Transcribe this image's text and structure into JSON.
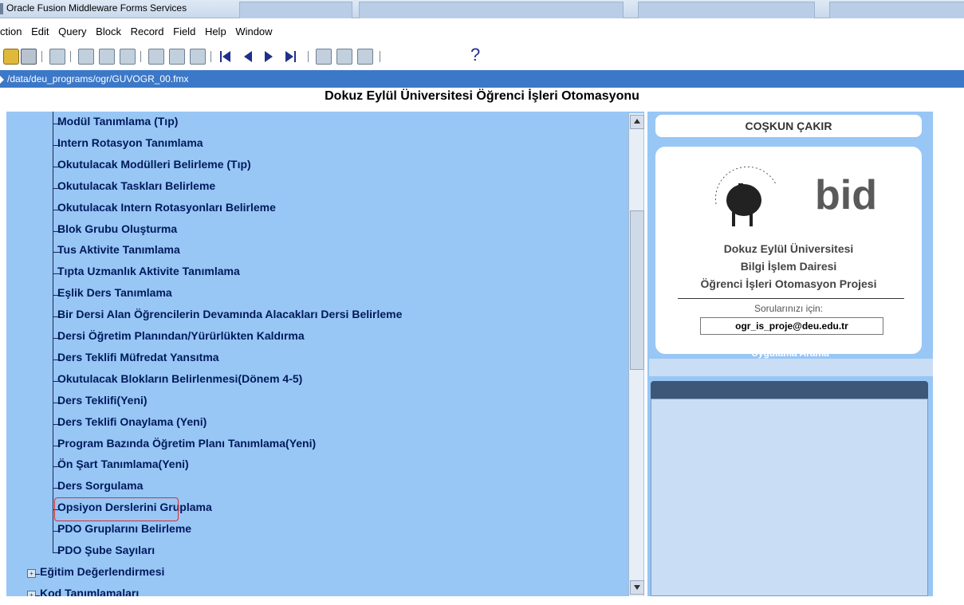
{
  "window": {
    "title": "Oracle Fusion Middleware Forms Services"
  },
  "menu": [
    "ction",
    "Edit",
    "Query",
    "Block",
    "Record",
    "Field",
    "Help",
    "Window"
  ],
  "toolbar": {
    "icons": [
      "folder-icon",
      "print-icon",
      "exit-icon",
      "cut-icon",
      "copy-icon",
      "paste-icon",
      "insert-record-icon",
      "delete-record-icon",
      "clear-record-icon",
      "first-record-icon",
      "previous-record-icon",
      "next-record-icon",
      "last-record-icon",
      "enter-query-icon",
      "cancel-query-icon",
      "execute-query-icon",
      "help-icon"
    ],
    "help_glyph": "?"
  },
  "pathbar": {
    "path": "/data/deu_programs/ogr/GUVOGR_00.fmx"
  },
  "page": {
    "title": "Dokuz Eylül Üniversitesi Öğrenci İşleri Otomasyonu"
  },
  "tree": {
    "children": [
      "Modül Tanımlama (Tıp)",
      "Intern Rotasyon Tanımlama",
      "Okutulacak Modülleri Belirleme (Tıp)",
      "Okutulacak Taskları Belirleme",
      "Okutulacak Intern Rotasyonları Belirleme",
      "Blok Grubu Oluşturma",
      "Tus Aktivite Tanımlama",
      "Tıpta Uzmanlık Aktivite Tanımlama",
      "Eşlik Ders Tanımlama",
      "Bir Dersi Alan Öğrencilerin Devamında Alacakları Dersi Belirleme",
      "Dersi Öğretim Planından/Yürürlükten Kaldırma",
      "Ders Teklifi Müfredat Yansıtma",
      "Okutulacak Blokların Belirlenmesi(Dönem 4-5)",
      "Ders Teklifi(Yeni)",
      "Ders Teklifi Onaylama (Yeni)",
      "Program Bazında Öğretim Planı Tanımlama(Yeni)",
      "Ön Şart Tanımlama(Yeni)",
      "Ders Sorgulama",
      "Opsiyon Derslerini Gruplama",
      "PDO Gruplarını Belirleme",
      "PDO Şube Sayıları"
    ],
    "folders": [
      "Eğitim Değerlendirmesi",
      "Kod Tanımlamaları"
    ],
    "selected": "Ders Teklifi(Yeni)",
    "colors": {
      "panel": "#98c6f5",
      "text": "#001a5c",
      "highlight": "#d93030"
    }
  },
  "user": {
    "name": "COŞKUN ÇAKIR"
  },
  "info": {
    "logo_text": "bid",
    "line1": "Dokuz Eylül Üniversitesi",
    "line2": "Bilgi İşlem Dairesi",
    "line3": "Öğrenci İşleri Otomasyon Projesi",
    "contact_label": "Sorularınızı için:",
    "email": "ogr_is_proje@deu.edu.tr"
  },
  "search": {
    "label": "Uygulama Arama",
    "value": ""
  },
  "colors": {
    "pathbar": "#3c78c8",
    "results_header": "#3d5779"
  }
}
